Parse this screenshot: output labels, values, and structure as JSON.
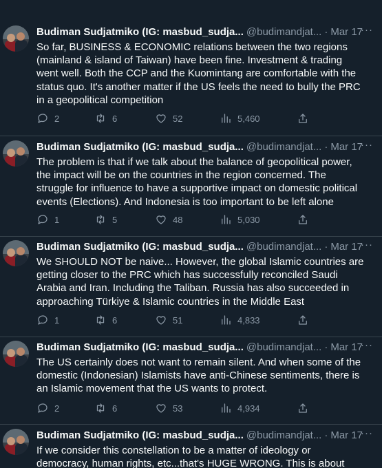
{
  "tweets": [
    {
      "name": "Budiman Sudjatmiko (IG: masbud_sudja...",
      "handle": "@budimandjat...",
      "date": "Mar 17",
      "text": "So far, BUSINESS & ECONOMIC relations between the two regions (mainland & island of Taiwan) have been fine. Investment & trading went well. Both the CCP and the Kuomintang are comfortable with the status quo. It's another matter if the US feels the need to bully the PRC in a geopolitical competition",
      "replies": "2",
      "retweets": "6",
      "likes": "52",
      "views": "5,460"
    },
    {
      "name": "Budiman Sudjatmiko (IG: masbud_sudja...",
      "handle": "@budimandjat...",
      "date": "Mar 17",
      "text": "The problem is that if we talk about the balance of geopolitical power, the impact will be on the countries in the region concerned. The struggle for influence to have a supportive impact on domestic political events (Elections). And Indonesia is too important to be left alone",
      "replies": "1",
      "retweets": "5",
      "likes": "48",
      "views": "5,030"
    },
    {
      "name": "Budiman Sudjatmiko (IG: masbud_sudja...",
      "handle": "@budimandjat...",
      "date": "Mar 17",
      "text": "We SHOULD NOT be naive... However, the global Islamic countries are getting closer to the PRC which has successfully reconciled Saudi Arabia and Iran. Including the Taliban. Russia has also succeeded in approaching Türkiye & Islamic countries in the Middle East",
      "replies": "1",
      "retweets": "6",
      "likes": "51",
      "views": "4,833"
    },
    {
      "name": "Budiman Sudjatmiko (IG: masbud_sudja...",
      "handle": "@budimandjat...",
      "date": "Mar 17",
      "text": "The US certainly does not want to remain silent. And when some of the domestic (Indonesian) Islamists have anti-Chinese sentiments, there is an Islamic movement that the US wants to protect.",
      "replies": "2",
      "retweets": "6",
      "likes": "53",
      "views": "4,934"
    },
    {
      "name": "Budiman Sudjatmiko (IG: masbud_sudja...",
      "handle": "@budimandjat...",
      "date": "Mar 17",
      "text": "If we consider this constellation to be a matter of ideology or democracy, human rights, etc...that's HUGE WRONG. This is about geopolitics,"
    }
  ],
  "more_icon": "more-horizontal-icon",
  "colors": {
    "background": "#15202b",
    "text": "#f7f9f9",
    "secondary": "#8b98a5",
    "divider": "#38444d"
  }
}
